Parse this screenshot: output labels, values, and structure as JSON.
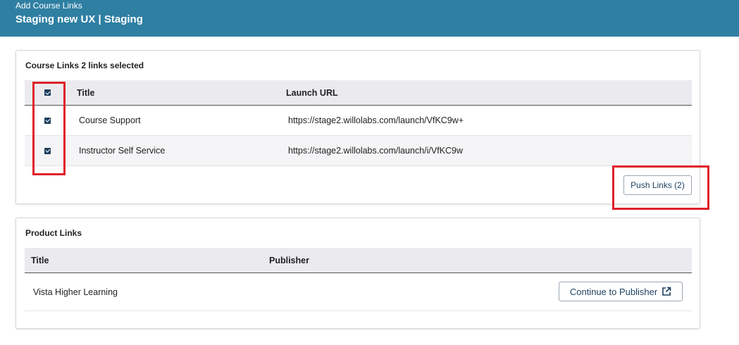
{
  "header": {
    "subtitle": "Add Course Links",
    "title": "Staging new UX | Staging",
    "bg_color": "#2f7fa3"
  },
  "course_links": {
    "title": "Course Links 2 links selected",
    "columns": [
      "Title",
      "Launch URL"
    ],
    "header_checked": true,
    "rows": [
      {
        "checked": true,
        "title": "Course Support",
        "url": "https://stage2.willolabs.com/launch/VfKC9w+"
      },
      {
        "checked": true,
        "title": "Instructor Self Service",
        "url": "https://stage2.willolabs.com/launch/i/VfKC9w"
      }
    ],
    "push_button": "Push Links (2)"
  },
  "product_links": {
    "title": "Product Links",
    "columns": [
      "Title",
      "Publisher"
    ],
    "rows": [
      {
        "title": "Vista Higher Learning",
        "button": "Continue to Publisher",
        "button_icon": "external-link-icon"
      }
    ]
  },
  "highlight_color": "#e0202a"
}
